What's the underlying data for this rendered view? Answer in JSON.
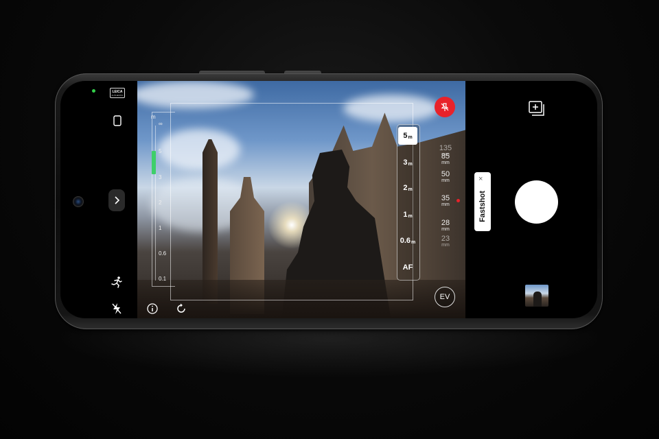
{
  "camera": {
    "brand_badge": {
      "line1": "LEICA",
      "line2": "AUTHENTIC"
    },
    "mode_toggle": "Fastshot",
    "mode_toggle_close": "×",
    "ev_label": "EV",
    "depth_scale": {
      "unit": "m",
      "labels": [
        "∞",
        "5",
        "3",
        "2",
        "1",
        "0.6",
        "0.1"
      ],
      "indicator_from": 5,
      "indicator_to": 3
    },
    "focus_distances": [
      {
        "value": "5",
        "unit": "m",
        "selected": true
      },
      {
        "value": "3",
        "unit": "m",
        "selected": false
      },
      {
        "value": "2",
        "unit": "m",
        "selected": false
      },
      {
        "value": "1",
        "unit": "m",
        "selected": false
      },
      {
        "value": "0.6",
        "unit": "m",
        "selected": false
      },
      {
        "value": "AF",
        "unit": "",
        "selected": false
      }
    ],
    "focal_lengths": [
      {
        "value": "135",
        "unit": "mm",
        "active": false,
        "faded": true
      },
      {
        "value": "85",
        "unit": "mm",
        "active": false,
        "faded": false
      },
      {
        "value": "50",
        "unit": "mm",
        "active": false,
        "faded": false
      },
      {
        "value": "35",
        "unit": "mm",
        "active": true,
        "faded": false
      },
      {
        "value": "28",
        "unit": "mm",
        "active": false,
        "faded": false
      },
      {
        "value": "23",
        "unit": "mm",
        "active": false,
        "faded": true
      }
    ],
    "colors": {
      "accent_red": "#e8222a",
      "depth_green": "#3ecf6a",
      "status_green": "#33d04a"
    },
    "icons": [
      "aspect-ratio-icon",
      "chevron-right-icon",
      "running-figure-icon",
      "flash-off-icon",
      "info-icon",
      "rotate-icon",
      "pin-icon",
      "add-layers-icon"
    ]
  }
}
